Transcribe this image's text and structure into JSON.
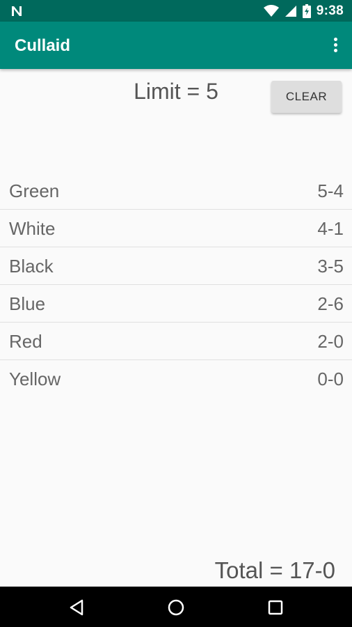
{
  "status_bar": {
    "time": "9:38",
    "icons": [
      "notification-n-icon",
      "wifi-icon",
      "cell-signal-icon",
      "battery-icon"
    ]
  },
  "app_bar": {
    "title": "Cullaid",
    "menu_icon": "more-vert-icon"
  },
  "header": {
    "limit_text": "Limit = 5",
    "clear_label": "CLEAR"
  },
  "colors": [
    {
      "name": "Green",
      "score": "5-4"
    },
    {
      "name": "White",
      "score": "4-1"
    },
    {
      "name": "Black",
      "score": "3-5"
    },
    {
      "name": "Blue",
      "score": "2-6"
    },
    {
      "name": "Red",
      "score": "2-0"
    },
    {
      "name": "Yellow",
      "score": "0-0"
    }
  ],
  "footer": {
    "total_text": "Total = 17-0"
  },
  "nav_bar": {
    "icons": [
      "back-icon",
      "home-icon",
      "recents-icon"
    ]
  },
  "theme": {
    "primary": "#00897b",
    "primary_dark": "#00695c",
    "background": "#fafafa"
  }
}
